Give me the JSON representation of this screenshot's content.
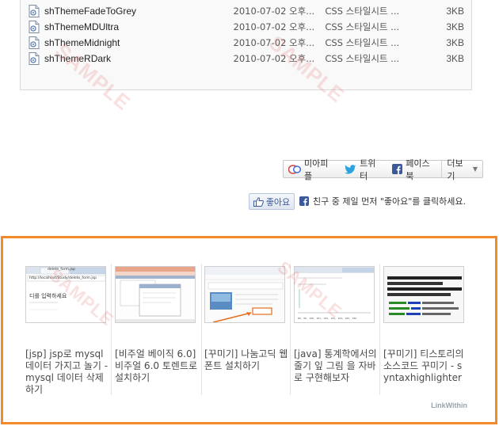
{
  "files": [
    {
      "name": "shThemeFadeToGrey",
      "date": "2010-07-02 오후...",
      "type": "CSS 스타일시트 ...",
      "size": "3KB"
    },
    {
      "name": "shThemeMDUltra",
      "date": "2010-07-02 오후...",
      "type": "CSS 스타일시트 ...",
      "size": "3KB"
    },
    {
      "name": "shThemeMidnight",
      "date": "2010-07-02 오후...",
      "type": "CSS 스타일시트 ...",
      "size": "3KB"
    },
    {
      "name": "shThemeRDark",
      "date": "2010-07-02 오후...",
      "type": "CSS 스타일시트 ...",
      "size": "3KB"
    }
  ],
  "watermark": "SAMPLE",
  "share": {
    "me2day": "미아피플",
    "twitter": "트위터",
    "facebook": "페이스북",
    "more": "더보기"
  },
  "like": {
    "button": "좋아요",
    "message": "친구 중 제일 먼저 \"좋아요\"를 클릭하세요."
  },
  "linkwithin": {
    "brand": "LinkWithin",
    "items": [
      {
        "caption": "[jsp] jsp로 mysql 데이터 가지고 놀기 - mysql 데이터 삭제하기",
        "thumb_text": "디를 입력하세요",
        "thumb_tab": "delete_form.jsp",
        "thumb_url": "http://localhost/Study/delete_form.jsp"
      },
      {
        "caption": "[비주얼 베이직 6.0] 비주얼 6.0 토렌트로 설치하기"
      },
      {
        "caption": "[꾸미기] 나눔고딕 웹 폰트 설치하기"
      },
      {
        "caption": "[java] 통계학에서의 줄기 잎 그림 을 자바로 구현해보자"
      },
      {
        "caption": "[꾸미기] 티스토리의 소스코드 꾸미기 - syntaxhighlighter"
      }
    ]
  },
  "colors": {
    "accent_orange": "#f28a2a",
    "facebook_blue": "#3b5998",
    "twitter_blue": "#2aa3e0"
  }
}
